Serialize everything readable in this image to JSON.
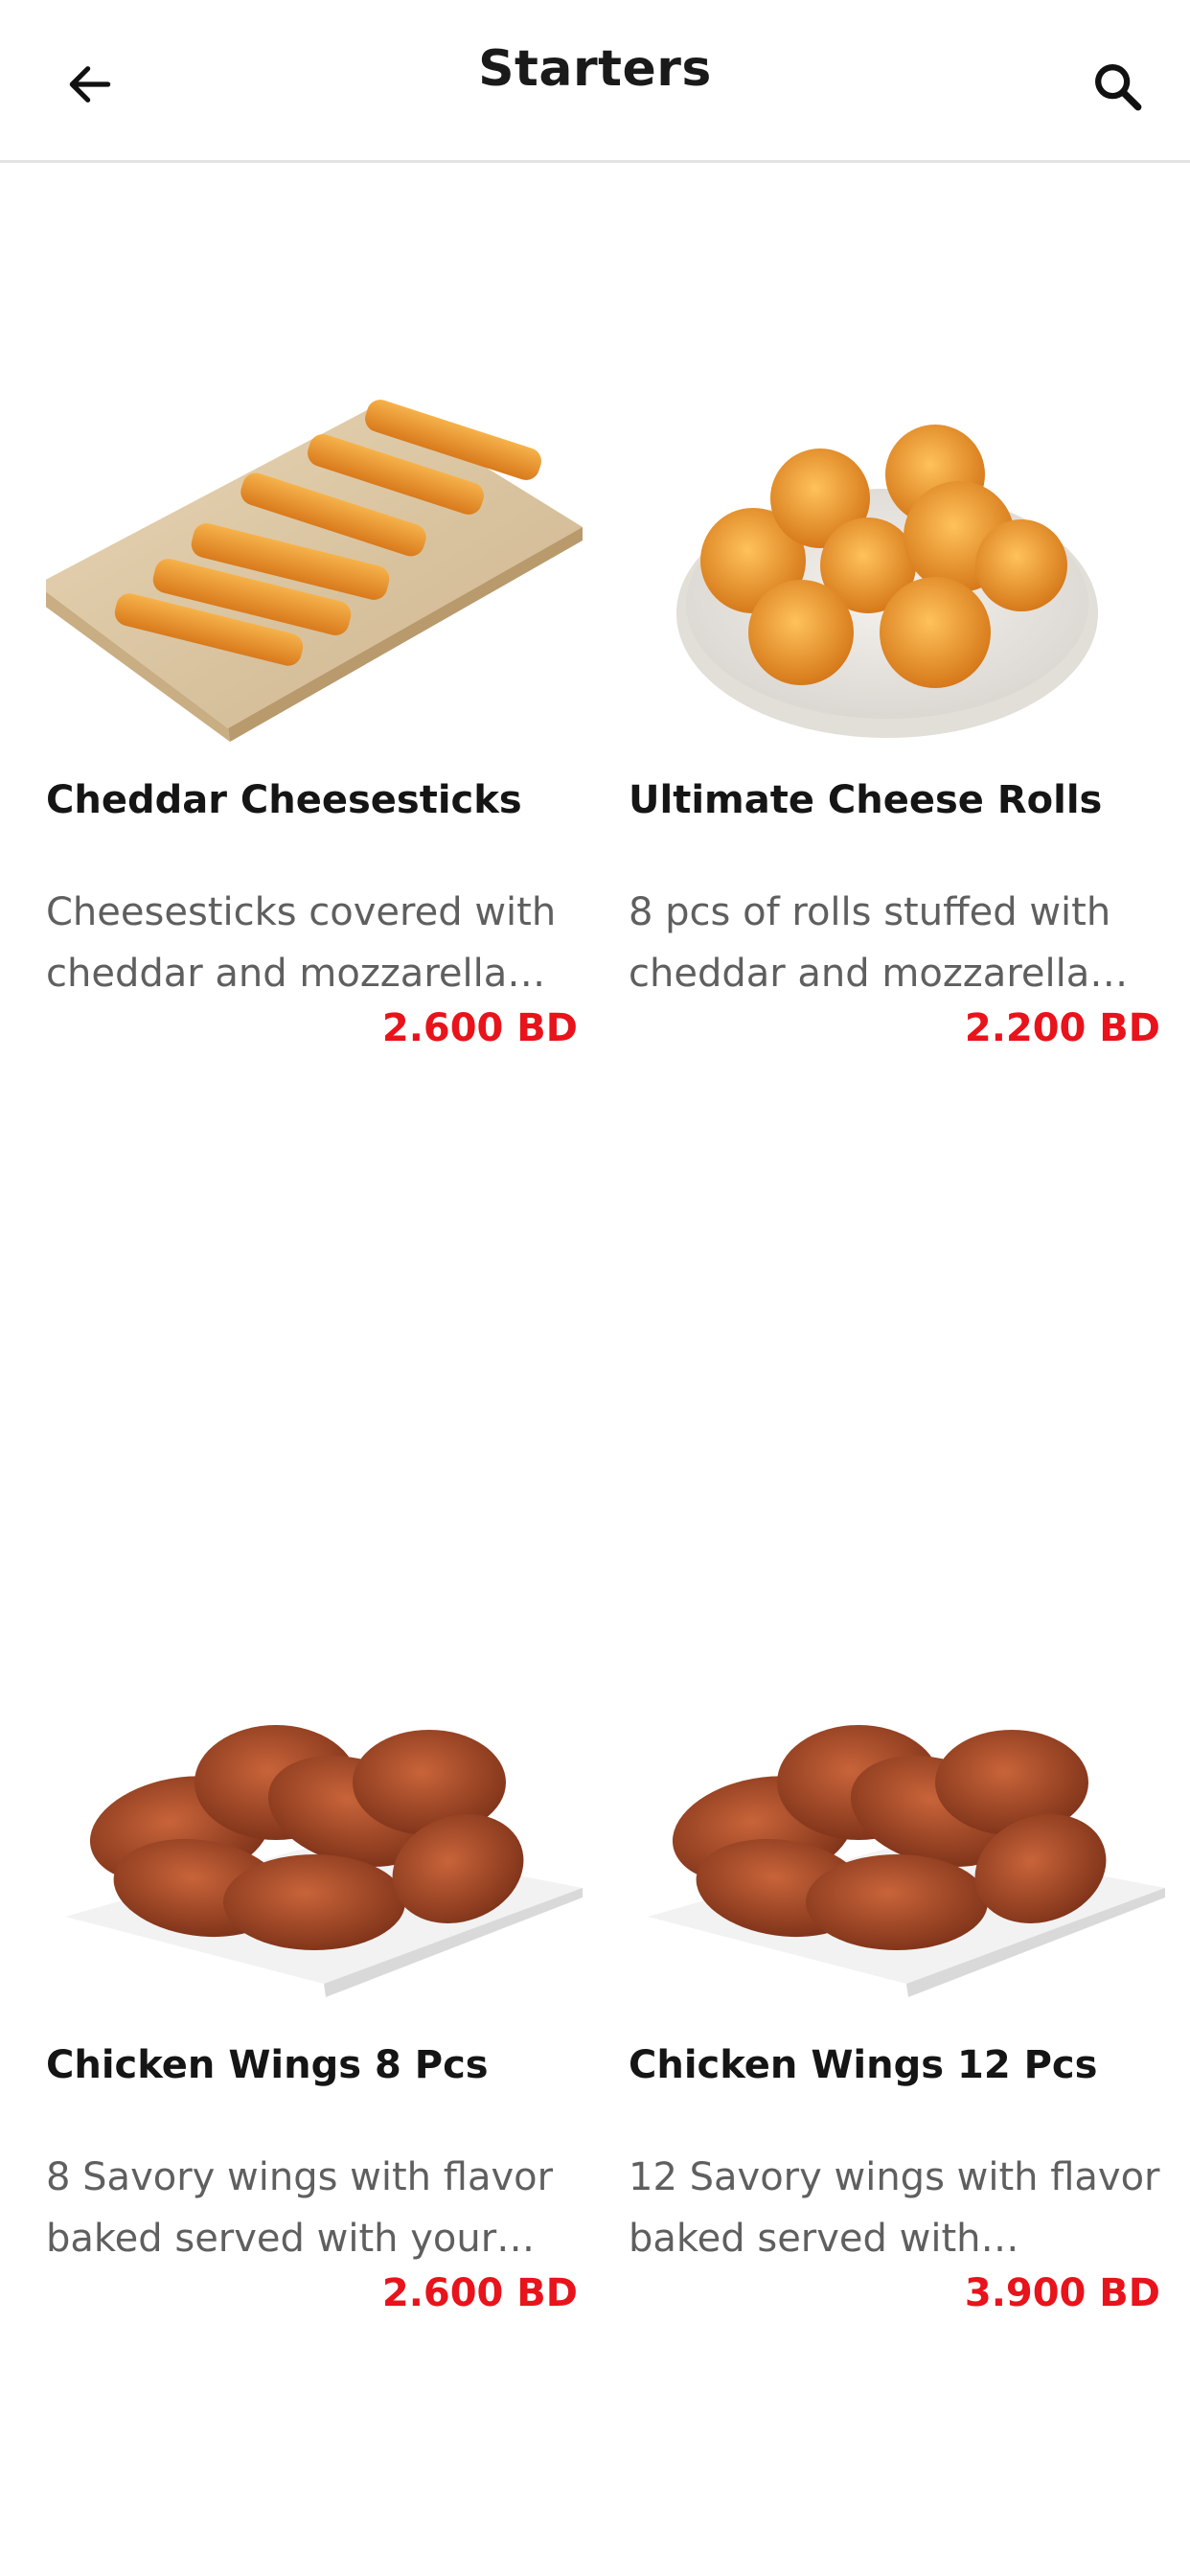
{
  "header": {
    "title": "Starters",
    "back_icon": "arrow-left-icon",
    "search_icon": "search-icon"
  },
  "colors": {
    "price": "#e8131b",
    "title": "#1a1a1a",
    "description": "#5f5f5f",
    "divider": "#e3e3e3"
  },
  "products": [
    {
      "name": "Cheddar Cheesesticks",
      "description": "Cheesesticks covered with cheddar and mozzarella…",
      "price": "2.600 BD",
      "image_icon": "cheesesticks-image"
    },
    {
      "name": "Ultimate Cheese Rolls",
      "description": "8 pcs of rolls stuffed with cheddar and mozzarella…",
      "price": "2.200 BD",
      "image_icon": "cheese-rolls-image"
    },
    {
      "name": "Chicken Wings 8 Pcs",
      "description": "8 Savory wings with flavor baked served with your…",
      "price": "2.600 BD",
      "image_icon": "chicken-wings-image"
    },
    {
      "name": "Chicken Wings 12 Pcs",
      "description": "12 Savory wings with flavor baked served with…",
      "price": "3.900 BD",
      "image_icon": "chicken-wings-image"
    }
  ]
}
